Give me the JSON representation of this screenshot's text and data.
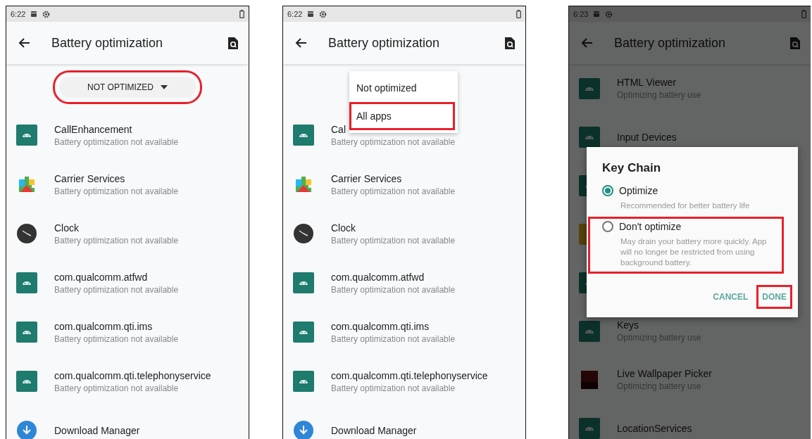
{
  "screens": [
    {
      "status_bar": {
        "time": "6:22"
      },
      "toolbar": {
        "title": "Battery optimization"
      },
      "filter": {
        "label": "NOT OPTIMIZED",
        "highlighted": true
      },
      "apps": [
        {
          "kind": "android",
          "name": "CallEnhancement",
          "status": "Battery optimization not available"
        },
        {
          "kind": "puzzle",
          "name": "Carrier Services",
          "status": "Battery optimization not available"
        },
        {
          "kind": "clock",
          "name": "Clock",
          "status": "Battery optimization not available"
        },
        {
          "kind": "android",
          "name": "com.qualcomm.atfwd",
          "status": "Battery optimization not available"
        },
        {
          "kind": "android",
          "name": "com.qualcomm.qti.ims",
          "status": "Battery optimization not available"
        },
        {
          "kind": "android",
          "name": "com.qualcomm.qti.telephonyservice",
          "status": "Battery optimization not available"
        },
        {
          "kind": "download",
          "name": "Download Manager"
        }
      ]
    },
    {
      "status_bar": {
        "time": "6:22"
      },
      "toolbar": {
        "title": "Battery optimization"
      },
      "menu": {
        "items": [
          {
            "label": "Not optimized",
            "highlighted": false
          },
          {
            "label": "All apps",
            "highlighted": true
          }
        ]
      },
      "apps": [
        {
          "kind": "android",
          "name": "Cal",
          "status": "Battery optimization not available"
        },
        {
          "kind": "puzzle",
          "name": "Carrier Services",
          "status": "Battery optimization not available"
        },
        {
          "kind": "clock",
          "name": "Clock",
          "status": "Battery optimization not available"
        },
        {
          "kind": "android",
          "name": "com.qualcomm.atfwd",
          "status": "Battery optimization not available"
        },
        {
          "kind": "android",
          "name": "com.qualcomm.qti.ims",
          "status": "Battery optimization not available"
        },
        {
          "kind": "android",
          "name": "com.qualcomm.qti.telephonyservice",
          "status": "Battery optimization not available"
        },
        {
          "kind": "download",
          "name": "Download Manager"
        }
      ]
    },
    {
      "status_bar": {
        "time": "6:23"
      },
      "toolbar": {
        "title": "Battery optimization"
      },
      "apps": [
        {
          "kind": "android",
          "name": "HTML Viewer",
          "status": "Optimizing battery use"
        },
        {
          "kind": "android",
          "name": "Input Devices"
        },
        {
          "kind": "android"
        },
        {
          "kind": "folder"
        },
        {
          "kind": "android"
        },
        {
          "kind": "android",
          "name": "Keys",
          "status": "Optimizing battery use"
        },
        {
          "kind": "wallpaper",
          "name": "Live Wallpaper Picker",
          "status": "Optimizing battery use"
        },
        {
          "kind": "android",
          "name": "LocationServices"
        }
      ],
      "dialog": {
        "title": "Key Chain",
        "options": [
          {
            "label": "Optimize",
            "description": "Recommended for better battery life",
            "selected": true,
            "highlighted": false
          },
          {
            "label": "Don't optimize",
            "description": "May drain your battery more quickly. App will no longer be restricted from using background battery.",
            "selected": false,
            "highlighted": true
          }
        ],
        "buttons": [
          {
            "label": "CANCEL",
            "highlighted": false
          },
          {
            "label": "DONE",
            "highlighted": true
          }
        ]
      }
    }
  ]
}
